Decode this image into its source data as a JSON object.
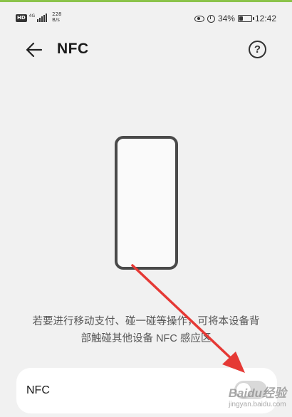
{
  "status_bar": {
    "hd_badge": "HD",
    "network_type": "4G",
    "speed_value": "228",
    "speed_unit": "B/s",
    "signal_icon": "signal-bars-icon",
    "battery_percent": "34%",
    "battery_level": 0.34,
    "time": "12:42",
    "icons": [
      "eye-comfort-icon",
      "alarm-icon",
      "battery-charging-icon"
    ]
  },
  "header": {
    "title": "NFC",
    "back_icon": "arrow-left-icon",
    "help_icon": "help-circle-icon",
    "help_glyph": "?"
  },
  "description": {
    "line1": "若要进行移动支付、碰一碰等操作，可将本设备背",
    "line2": "部触碰其他设备 NFC 感应区"
  },
  "nfc_setting": {
    "label": "NFC",
    "enabled": false
  },
  "watermark": {
    "brand": "Baidu经验",
    "sub": "jingyan.baidu.com"
  },
  "colors": {
    "accent_top": "#8bc34a",
    "annotation_arrow": "#e53935",
    "background": "#f1f1f1",
    "toggle_off": "#d9d9d9"
  }
}
